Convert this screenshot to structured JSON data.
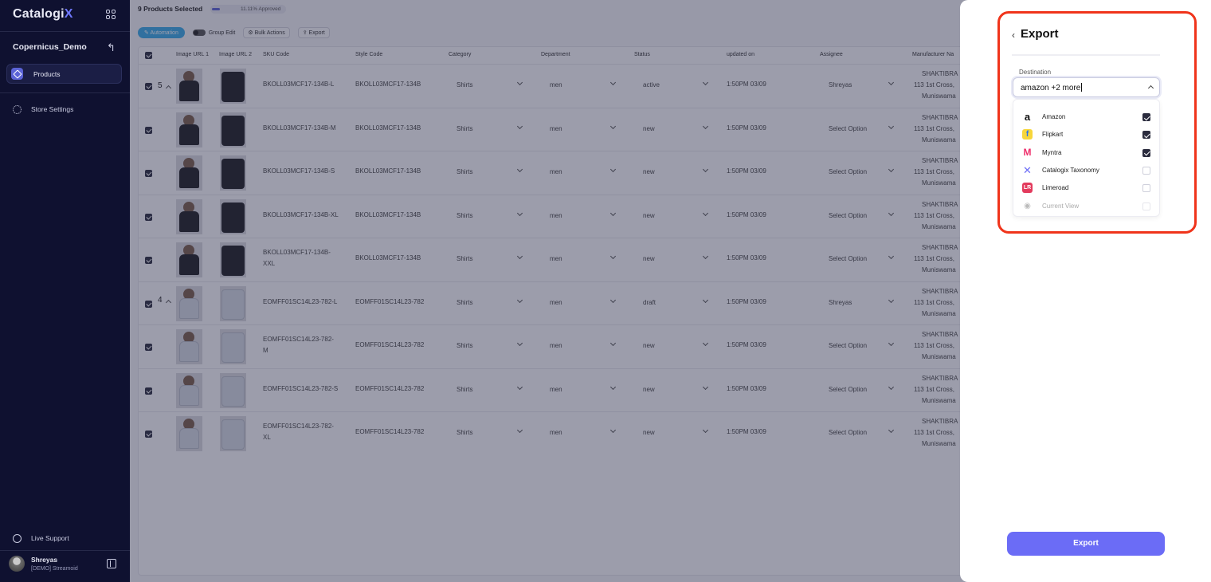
{
  "app": {
    "logo_main": "Catalogi",
    "logo_accent": "X"
  },
  "sidebar": {
    "store_name": "Copernicus_Demo",
    "products_label": "Products",
    "store_settings_label": "Store Settings",
    "live_support_label": "Live Support",
    "user_name": "Shreyas",
    "user_org": "[DEMO] Streamoid"
  },
  "toolbar": {
    "selected_text": "9 Products Selected",
    "approved_text": "11.11% Approved",
    "approved_progress": 0.1111,
    "automation_label": "Automation",
    "group_edit_label": "Group Edit",
    "bulk_actions_label": "Bulk Actions",
    "export_label": "Export"
  },
  "table": {
    "headers": [
      "Image URL 1",
      "Image URL 2",
      "SKU Code",
      "Style Code",
      "Category",
      "Department",
      "Status",
      "updated on",
      "Assignee",
      "Manufacturer Na"
    ],
    "group1_count": "5",
    "group2_count": "4",
    "rows": [
      {
        "sku": "BKOLL03MCF17-134B-L",
        "style": "BKOLL03MCF17-134B",
        "category": "Shirts",
        "department": "men",
        "status": "active",
        "updated": "1:50PM 03/09",
        "assignee": "Shreyas",
        "m1": "SHAKTIBRA",
        "m2": "113 1st Cross,",
        "m3": "Muniswama"
      },
      {
        "sku": "BKOLL03MCF17-134B-M",
        "style": "BKOLL03MCF17-134B",
        "category": "Shirts",
        "department": "men",
        "status": "new",
        "updated": "1:50PM 03/09",
        "assignee": "Select Option",
        "m1": "SHAKTIBRA",
        "m2": "113 1st Cross,",
        "m3": "Muniswama"
      },
      {
        "sku": "BKOLL03MCF17-134B-S",
        "style": "BKOLL03MCF17-134B",
        "category": "Shirts",
        "department": "men",
        "status": "new",
        "updated": "1:50PM 03/09",
        "assignee": "Select Option",
        "m1": "SHAKTIBRA",
        "m2": "113 1st Cross,",
        "m3": "Muniswama"
      },
      {
        "sku": "BKOLL03MCF17-134B-XL",
        "style": "BKOLL03MCF17-134B",
        "category": "Shirts",
        "department": "men",
        "status": "new",
        "updated": "1:50PM 03/09",
        "assignee": "Select Option",
        "m1": "SHAKTIBRA",
        "m2": "113 1st Cross,",
        "m3": "Muniswama"
      },
      {
        "sku": "BKOLL03MCF17-134B-",
        "sku2": "XXL",
        "style": "BKOLL03MCF17-134B",
        "category": "Shirts",
        "department": "men",
        "status": "new",
        "updated": "1:50PM 03/09",
        "assignee": "Select Option",
        "m1": "SHAKTIBRA",
        "m2": "113 1st Cross,",
        "m3": "Muniswama"
      },
      {
        "sku": "EOMFF01SC14L23-782-L",
        "style": "EOMFF01SC14L23-782",
        "category": "Shirts",
        "department": "men",
        "status": "draft",
        "updated": "1:50PM 03/09",
        "assignee": "Shreyas",
        "m1": "SHAKTIBRA",
        "m2": "113 1st Cross,",
        "m3": "Muniswama"
      },
      {
        "sku": "EOMFF01SC14L23-782-",
        "sku2": "M",
        "style": "EOMFF01SC14L23-782",
        "category": "Shirts",
        "department": "men",
        "status": "new",
        "updated": "1:50PM 03/09",
        "assignee": "Select Option",
        "m1": "SHAKTIBRA",
        "m2": "113 1st Cross,",
        "m3": "Muniswama"
      },
      {
        "sku": "EOMFF01SC14L23-782-S",
        "style": "EOMFF01SC14L23-782",
        "category": "Shirts",
        "department": "men",
        "status": "new",
        "updated": "1:50PM 03/09",
        "assignee": "Select Option",
        "m1": "SHAKTIBRA",
        "m2": "113 1st Cross,",
        "m3": "Muniswama"
      },
      {
        "sku": "EOMFF01SC14L23-782-",
        "sku2": "XL",
        "style": "EOMFF01SC14L23-782",
        "category": "Shirts",
        "department": "men",
        "status": "new",
        "updated": "1:50PM 03/09",
        "assignee": "Select Option",
        "m1": "SHAKTIBRA",
        "m2": "113 1st Cross,",
        "m3": "Muniswama"
      }
    ]
  },
  "export_panel": {
    "title": "Export",
    "back_glyph": "‹",
    "destination_label": "Destination",
    "destination_value": "amazon +2 more",
    "options": [
      {
        "name": "Amazon",
        "checked": true,
        "icon": "amazon-logo"
      },
      {
        "name": "Flipkart",
        "checked": true,
        "icon": "flipkart-logo"
      },
      {
        "name": "Myntra",
        "checked": true,
        "icon": "myntra-logo"
      },
      {
        "name": "Catalogix Taxonomy",
        "checked": false,
        "icon": "catalogix-logo"
      },
      {
        "name": "Limeroad",
        "checked": false,
        "icon": "limeroad-logo"
      },
      {
        "name": "Current View",
        "checked": false,
        "icon": "eye-icon",
        "disabled": true
      }
    ],
    "export_button": "Export",
    "highlight_color": "#f0341b",
    "accent_color": "#6b6cf6"
  }
}
